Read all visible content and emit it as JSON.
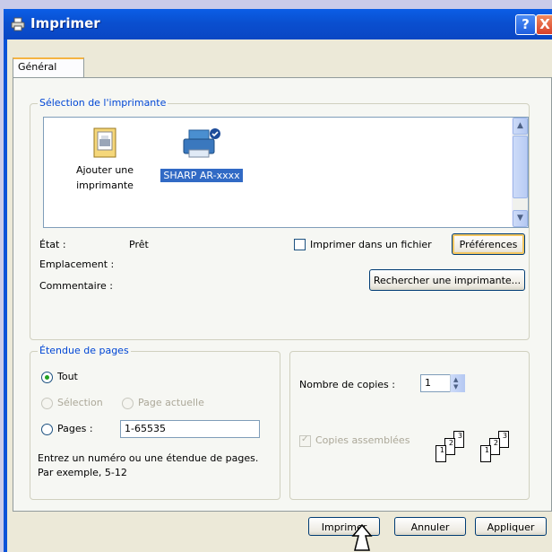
{
  "window": {
    "title": "Imprimer",
    "help_label": "?",
    "close_label": "X"
  },
  "tabs": [
    {
      "label": "Général",
      "selected": true
    }
  ],
  "printer_selection": {
    "legend": "Sélection de l'imprimante",
    "printers": [
      {
        "label": "Ajouter une imprimante",
        "icon": "add-printer-icon",
        "selected": false
      },
      {
        "label": "SHARP AR-xxxx",
        "icon": "printer-icon",
        "selected": true
      }
    ],
    "status_label": "État :",
    "status_value": "Prêt",
    "location_label": "Emplacement :",
    "location_value": "",
    "comment_label": "Commentaire :",
    "comment_value": "",
    "print_to_file_label": "Imprimer dans un fichier",
    "print_to_file_checked": false,
    "preferences_label": "Préférences",
    "find_printer_label": "Rechercher une imprimante..."
  },
  "page_range": {
    "legend": "Étendue de pages",
    "all_label": "Tout",
    "selection_label": "Sélection",
    "current_page_label": "Page actuelle",
    "pages_label": "Pages :",
    "pages_value": "1-65535",
    "selected": "all",
    "hint_line1": "Entrez un numéro ou une étendue de pages.",
    "hint_line2": "Par exemple, 5-12"
  },
  "copies": {
    "count_label": "Nombre de copies :",
    "count_value": "1",
    "collate_label": "Copies assemblées",
    "collate_checked": true,
    "collate_pages": [
      "1",
      "2",
      "3"
    ]
  },
  "buttons": {
    "print": "Imprimer",
    "cancel": "Annuler",
    "apply": "Appliquer"
  },
  "colors": {
    "titlebar": "#0a52d8",
    "dialog_bg": "#ece9d8",
    "group_legend": "#0046d5",
    "selection": "#316ac5"
  }
}
